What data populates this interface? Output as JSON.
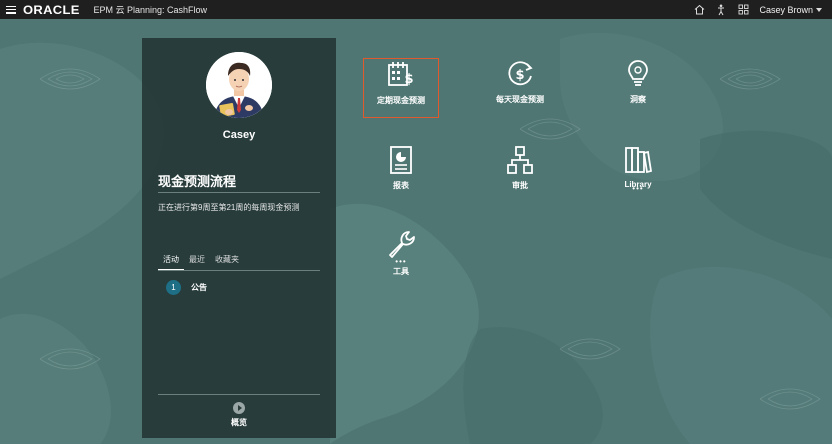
{
  "topbar": {
    "logo": "ORACLE",
    "app_title": "EPM 云 Planning: CashFlow",
    "user_name": "Casey Brown",
    "icons": [
      "home-icon",
      "accessibility-icon",
      "grid-navigator-icon"
    ]
  },
  "panel": {
    "user_name": "Casey",
    "flow_title": "现金预测流程",
    "flow_desc": "正在进行第9周至第21周的每周现金预测",
    "tabs": [
      {
        "label": "活动",
        "active": true
      },
      {
        "label": "最近",
        "active": false
      },
      {
        "label": "收藏夹",
        "active": false
      }
    ],
    "items": [
      {
        "number": "1",
        "label": "公告"
      }
    ],
    "overview_label": "概览"
  },
  "tiles": [
    {
      "label": "定期现金预测",
      "icon": "calendar-dollar-icon",
      "selected": true
    },
    {
      "label": "每天现金预测",
      "icon": "dollar-refresh-icon",
      "selected": false
    },
    {
      "label": "洞察",
      "icon": "lightbulb-icon",
      "selected": false
    },
    {
      "label": "报表",
      "icon": "report-icon",
      "selected": false
    },
    {
      "label": "审批",
      "icon": "approval-hierarchy-icon",
      "selected": false
    },
    {
      "label": "Library",
      "icon": "library-icon",
      "selected": false
    },
    {
      "label": "工具",
      "icon": "wrench-icon",
      "selected": false
    }
  ],
  "colors": {
    "topbar": "#1f1f1f",
    "background": "#4f7673",
    "panel": "#223433",
    "selected_border": "#e05a2e",
    "badge": "#1e6f86"
  }
}
